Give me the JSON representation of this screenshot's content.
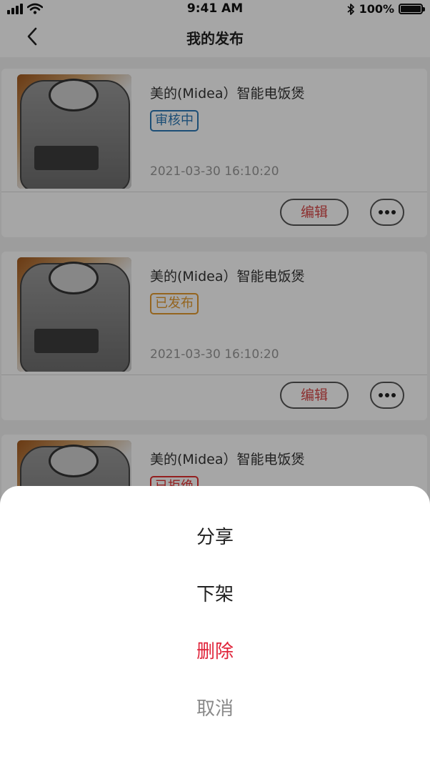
{
  "status_bar": {
    "time": "9:41 AM",
    "battery": "100%",
    "battery_level": 1.0
  },
  "nav": {
    "title": "我的发布"
  },
  "posts": [
    {
      "title": "美的(Midea）智能电饭煲",
      "status": "审核中",
      "date": "2021-03-30   16:10:20",
      "edit_label": "编辑"
    },
    {
      "title": "美的(Midea）智能电饭煲",
      "status": "已发布",
      "date": "2021-03-30   16:10:20",
      "edit_label": "编辑"
    },
    {
      "title": "美的(Midea）智能电饭煲",
      "status": "已拒绝",
      "date": "",
      "edit_label": ""
    }
  ],
  "action_sheet": {
    "share": "分享",
    "unlist": "下架",
    "delete": "删除",
    "cancel": "取消"
  },
  "colors": {
    "status_review": "#2b78b5",
    "status_published": "#e39a2e",
    "status_rejected": "#e23030",
    "danger": "#e0243a"
  }
}
